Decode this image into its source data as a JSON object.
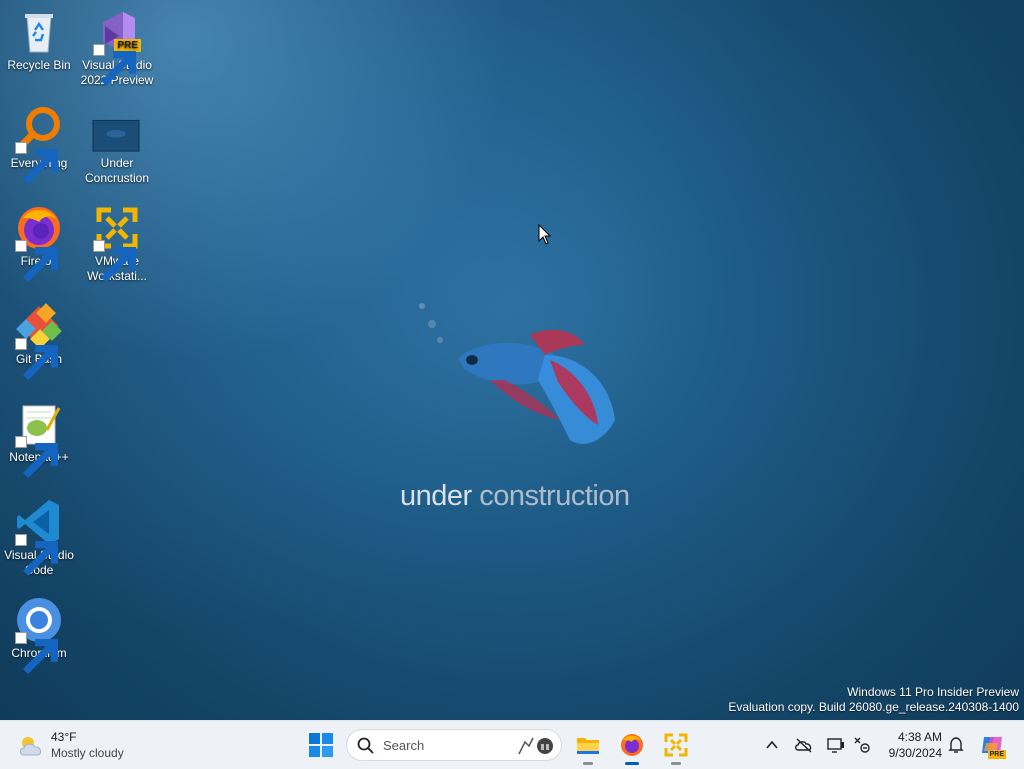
{
  "wallpaper": {
    "text_bold": "under",
    "text_light": " construction"
  },
  "desktop_icons": [
    {
      "id": "recycle-bin",
      "label": "Recycle Bin",
      "icon": "recycle-bin-icon",
      "shortcut": false
    },
    {
      "id": "visual-studio-2022-preview",
      "label": "Visual Studio 2022 Preview",
      "icon": "visual-studio-preview-icon",
      "shortcut": true,
      "badge": "PRE"
    },
    {
      "id": "everything",
      "label": "Everything",
      "icon": "everything-search-icon",
      "shortcut": true
    },
    {
      "id": "under-concruction",
      "label": "Under Concrustion",
      "icon": "image-file-icon",
      "shortcut": false
    },
    {
      "id": "firefox",
      "label": "Firefox",
      "icon": "firefox-icon",
      "shortcut": true
    },
    {
      "id": "vmware-workstation",
      "label": "VMware Workstati...",
      "icon": "vmware-icon",
      "shortcut": true
    },
    {
      "id": "git-bash",
      "label": "Git Bash",
      "icon": "git-bash-icon",
      "shortcut": true
    },
    {
      "id": "notepad-plus-plus",
      "label": "Notepad++",
      "icon": "notepad-plus-plus-icon",
      "shortcut": true
    },
    {
      "id": "visual-studio-code",
      "label": "Visual Studio Code",
      "icon": "vscode-icon",
      "shortcut": true
    },
    {
      "id": "chromium",
      "label": "Chromium",
      "icon": "chromium-icon",
      "shortcut": true
    }
  ],
  "watermark": {
    "line1": "Windows 11 Pro Insider Preview",
    "line2": "Evaluation copy. Build 26080.ge_release.240308-1400"
  },
  "taskbar": {
    "weather": {
      "temp": "43°F",
      "condition": "Mostly cloudy",
      "icon": "partly-cloudy-icon"
    },
    "search": {
      "placeholder": "Search"
    },
    "pinned_apps": [
      {
        "name": "File Explorer",
        "icon": "file-explorer-icon",
        "running": true,
        "active": false
      },
      {
        "name": "Firefox",
        "icon": "firefox-icon",
        "running": true,
        "active": true
      },
      {
        "name": "VMware Workstation",
        "icon": "vmware-icon",
        "running": true,
        "active": false
      }
    ],
    "tray": {
      "icons": [
        "chevron-up-icon",
        "onedrive-offline-icon",
        "display-icon",
        "network-icon",
        "notification-bell-icon",
        "copilot-icon"
      ],
      "copilot_badge": "PRE"
    },
    "clock": {
      "time": "4:38 AM",
      "date": "9/30/2024"
    }
  },
  "colors": {
    "accent": "#005fb8",
    "taskbar_bg": "#eef1f5",
    "wallpaper_dark": "#0f3a58",
    "wallpaper_mid": "#1d5a85"
  }
}
